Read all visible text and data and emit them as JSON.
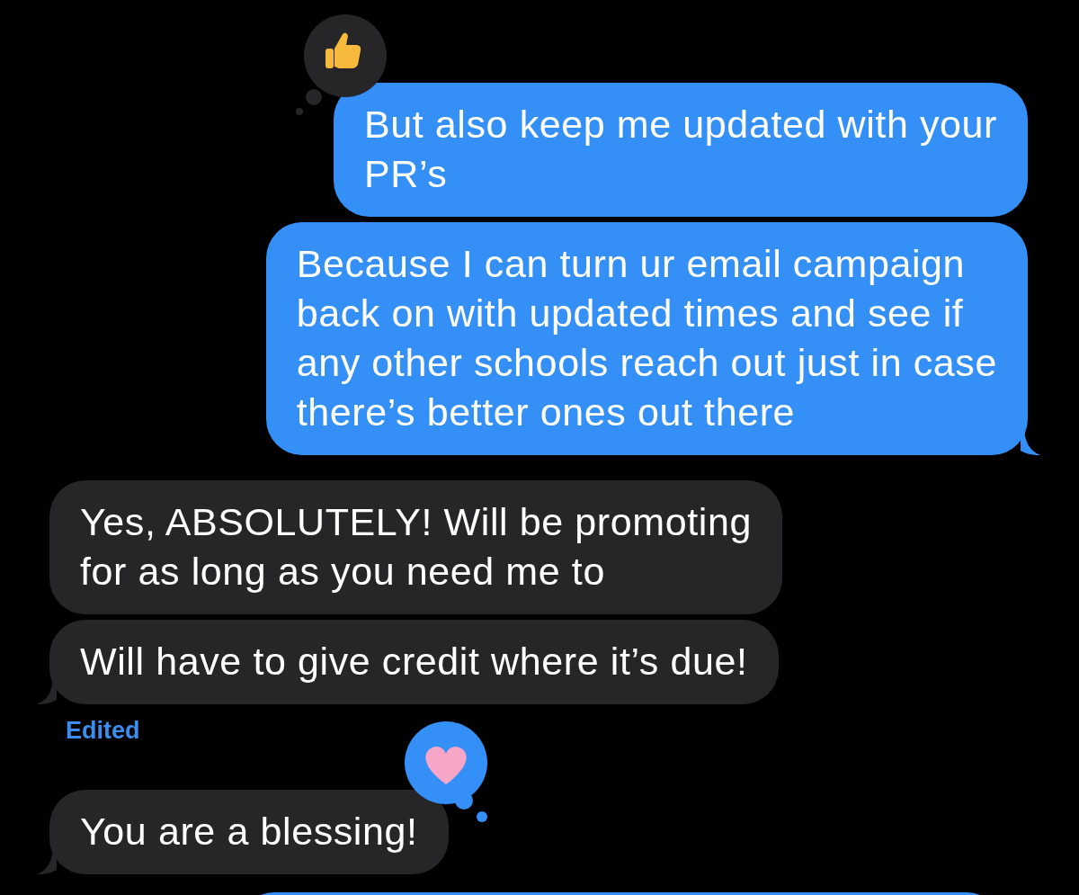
{
  "messages": [
    {
      "outgoing": true,
      "tail": false,
      "lines": [
        "But also keep me updated with your",
        "PR’s"
      ],
      "reaction": {
        "kind": "like",
        "mine": false
      }
    },
    {
      "outgoing": true,
      "tail": true,
      "lines": [
        "Because I can turn ur email campaign",
        "back on with updated times and see if",
        "any other schools reach out just in case",
        "there’s better ones out there"
      ]
    },
    {
      "outgoing": false,
      "tail": false,
      "lines": [
        "Yes, ABSOLUTELY! Will be promoting",
        "for as long as you need me to"
      ]
    },
    {
      "outgoing": false,
      "tail": true,
      "lines": [
        "Will have to give credit where it’s due!"
      ],
      "edited_label": "Edited"
    },
    {
      "outgoing": false,
      "tail": true,
      "lines": [
        "You are a blessing!"
      ],
      "reaction": {
        "kind": "love",
        "mine": true
      }
    },
    {
      "outgoing": true
    }
  ]
}
